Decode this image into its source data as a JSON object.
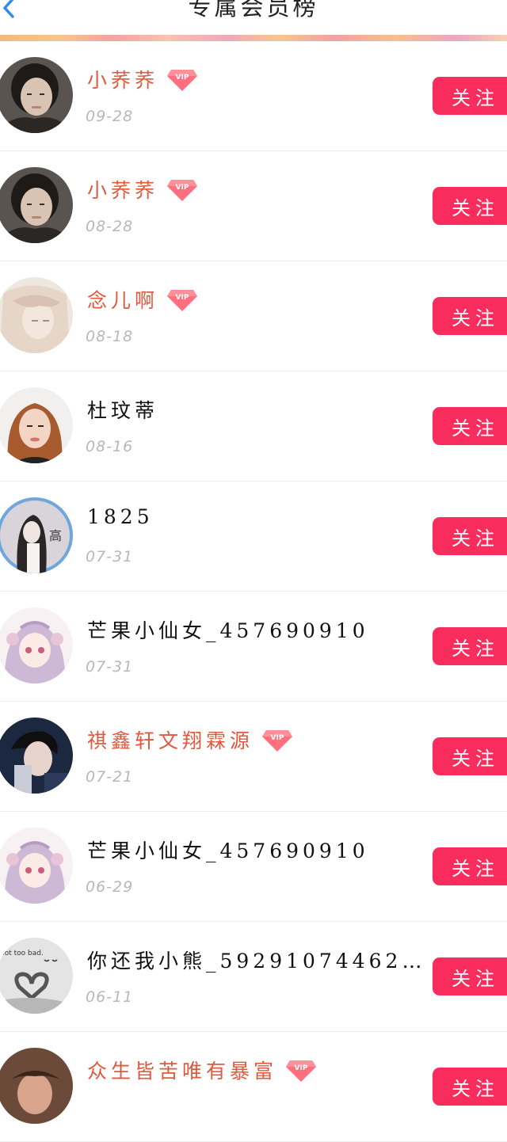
{
  "header": {
    "title": "专属会员榜",
    "back_icon": "chevron-left-icon",
    "accent_color": "#2f8cf0"
  },
  "follow_color": "#f92d5d",
  "vip_name_color": "#e0593e",
  "members": [
    {
      "name": "小荞荞",
      "date": "09-28",
      "vip": true,
      "follow_label": "关注",
      "avatar": "photo-girl-dark-hair"
    },
    {
      "name": "小荞荞",
      "date": "08-28",
      "vip": true,
      "follow_label": "关注",
      "avatar": "photo-girl-dark-hair"
    },
    {
      "name": "念儿啊",
      "date": "08-18",
      "vip": true,
      "follow_label": "关注",
      "avatar": "illustration-pastel-girl"
    },
    {
      "name": "杜玟蒂",
      "date": "08-16",
      "vip": false,
      "follow_label": "关注",
      "avatar": "photo-girl-auburn-hair"
    },
    {
      "name": "1825",
      "date": "07-31",
      "vip": false,
      "follow_label": "关注",
      "avatar": "photo-girl-mirror-selfie"
    },
    {
      "name": "芒果小仙女_457690910",
      "date": "07-31",
      "vip": false,
      "follow_label": "关注",
      "avatar": "anime-girl-pink"
    },
    {
      "name": "祺鑫轩文翔霖源",
      "date": "07-21",
      "vip": true,
      "follow_label": "关注",
      "avatar": "photo-boy-dark"
    },
    {
      "name": "芒果小仙女_457690910",
      "date": "06-29",
      "vip": false,
      "follow_label": "关注",
      "avatar": "anime-girl-pink"
    },
    {
      "name": "你还我小熊_59291074462…",
      "date": "06-11",
      "vip": false,
      "follow_label": "关注",
      "avatar": "photo-heart-hands"
    },
    {
      "name": "众生皆苦唯有暴富",
      "date": "",
      "vip": true,
      "follow_label": "关注",
      "avatar": "photo-partial"
    }
  ]
}
